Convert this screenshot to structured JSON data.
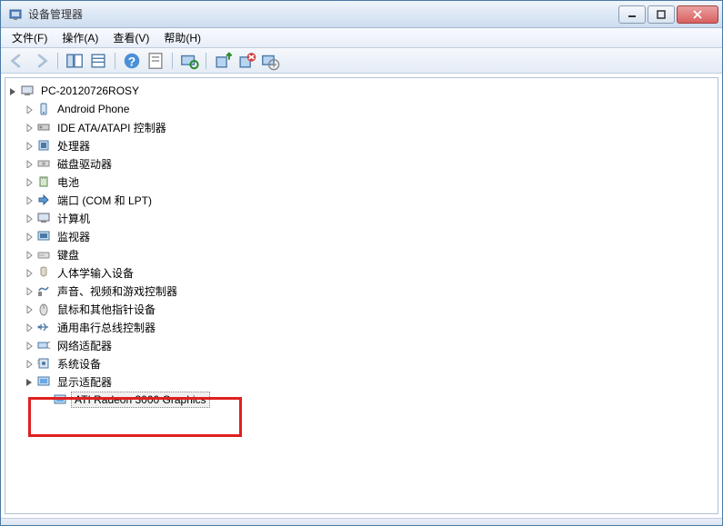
{
  "window": {
    "title": "设备管理器"
  },
  "menu": {
    "file": "文件(F)",
    "action": "操作(A)",
    "view": "查看(V)",
    "help": "帮助(H)"
  },
  "toolbar": {
    "back": "后退",
    "forward": "前进",
    "up": "向上",
    "show_hide": "显示/隐藏控制台树",
    "properties": "属性",
    "help": "帮助",
    "export": "导出列表",
    "scan": "扫描检测硬件改动",
    "add": "添加过时硬件",
    "uninstall": "卸载",
    "update": "更新驱动程序"
  },
  "tree": {
    "root": "PC-20120726ROSY",
    "categories": [
      "Android Phone",
      "IDE ATA/ATAPI 控制器",
      "处理器",
      "磁盘驱动器",
      "电池",
      "端口 (COM 和 LPT)",
      "计算机",
      "监视器",
      "键盘",
      "人体学输入设备",
      "声音、视频和游戏控制器",
      "鼠标和其他指针设备",
      "通用串行总线控制器",
      "网络适配器",
      "系统设备",
      "显示适配器"
    ],
    "display_adapter_child": "ATI Radeon 3000 Graphics"
  },
  "colors": {
    "highlight": "#e02020",
    "titlebar_start": "#f0f5fb",
    "titlebar_end": "#cdddf0"
  }
}
